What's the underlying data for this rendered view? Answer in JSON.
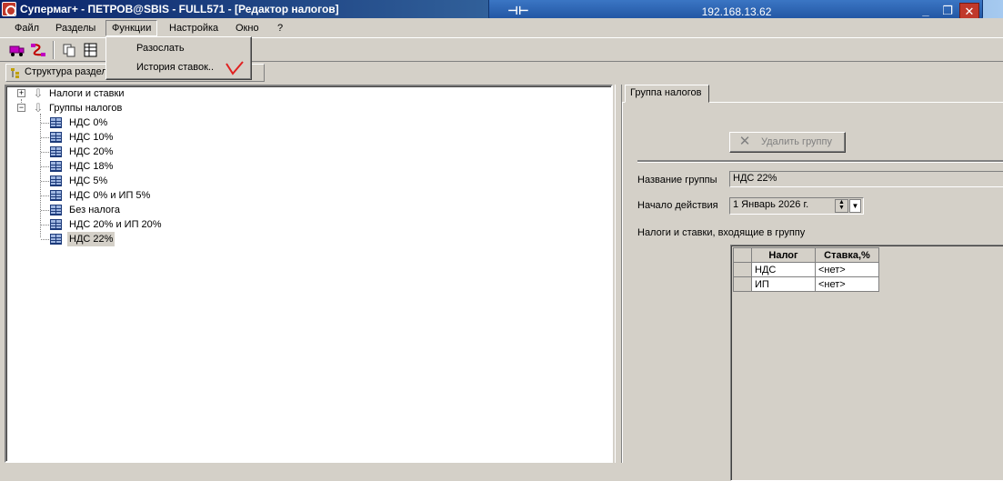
{
  "window": {
    "title": "Супермаг+ - ПЕТРОВ@SBIS - FULL571  - [Редактор налогов]"
  },
  "rdp": {
    "host": "192.168.13.62",
    "pin_glyph": "⊣⊢",
    "minimize_glyph": "_",
    "restore_glyph": "❐",
    "close_glyph": "✕"
  },
  "menubar": {
    "items": [
      "Файл",
      "Разделы",
      "Функции",
      "Настройка",
      "Окно",
      "?"
    ],
    "active": "Функции"
  },
  "dropdown": {
    "items": [
      "Разослать",
      "История ставок.."
    ]
  },
  "struct_tab": {
    "label": "Структура раздела"
  },
  "tree": {
    "roots": [
      {
        "label": "Налоги и ставки",
        "expander": "+"
      },
      {
        "label": "Группы налогов",
        "expander": "−"
      }
    ],
    "groups": [
      "НДС 0%",
      "НДС 10%",
      "НДС 20%",
      "НДС 18%",
      "НДС 5%",
      "НДС 0% и ИП 5%",
      "Без налога",
      "НДС 20% и ИП 20%",
      "НДС 22%"
    ],
    "selected": "НДС 22%"
  },
  "right": {
    "tab_label": "Группа налогов",
    "delete_button": "Удалить группу",
    "name_label": "Название группы",
    "name_value": "НДС 22%",
    "start_label": "Начало действия",
    "start_value": "1   Январь  2026 г.",
    "grid_title": "Налоги и ставки, входящие в группу",
    "grid": {
      "columns": [
        "Налог",
        "Ставка,%"
      ],
      "rows": [
        [
          "НДС",
          "<нет>"
        ],
        [
          "ИП",
          "<нет>"
        ]
      ]
    }
  },
  "colors": {
    "face": "#d4d0c8",
    "title_start": "#0a246a",
    "rdp_bar": "#2a5fae",
    "check_mark": "#e02020"
  }
}
